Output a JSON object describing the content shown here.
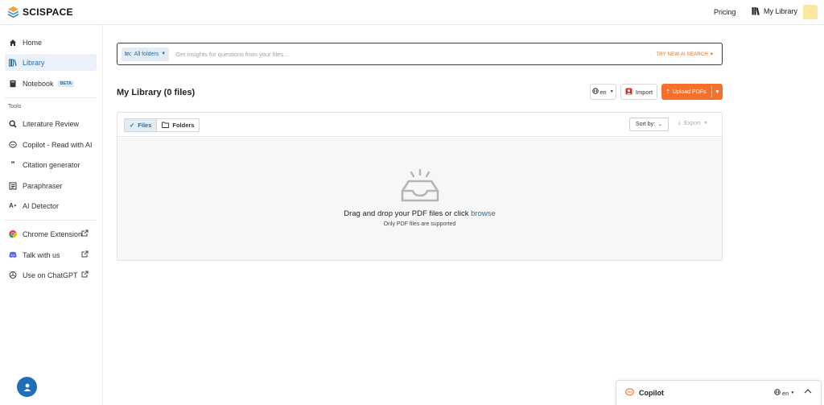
{
  "header": {
    "brand": "SCISPACE",
    "pricing": "Pricing",
    "my_library": "My Library"
  },
  "sidebar": {
    "items": [
      {
        "label": "Home"
      },
      {
        "label": "Library"
      },
      {
        "label": "Notebook",
        "badge": "BETA"
      }
    ],
    "tools_label": "Tools",
    "tools": [
      {
        "label": "Literature Review"
      },
      {
        "label": "Copilot - Read with AI"
      },
      {
        "label": "Citation generator"
      },
      {
        "label": "Paraphraser"
      },
      {
        "label": "AI Detector"
      }
    ],
    "external": [
      {
        "label": "Chrome Extension"
      },
      {
        "label": "Talk with us"
      },
      {
        "label": "Use on ChatGPT"
      }
    ]
  },
  "search": {
    "scope_prefix": "In:",
    "scope_value": "All folders",
    "placeholder": "Get insights for questions from your files...",
    "try_ai": "TRY NEW AI SEARCH"
  },
  "library": {
    "title": "My Library (0 files)",
    "lang": "en",
    "import": "Import",
    "upload": "Upload PDFs"
  },
  "panel": {
    "tab_files": "Files",
    "tab_folders": "Folders",
    "sort_by": "Sort by:",
    "export": "Export",
    "drop_text": "Drag and drop your PDF files or click",
    "browse": "browse",
    "drop_sub": "Only PDF files are supported"
  },
  "copilot": {
    "label": "Copilot",
    "lang": "en"
  },
  "colors": {
    "accent": "#f4702b",
    "primary": "#2a6ea3",
    "fab": "#1e6fb8"
  }
}
